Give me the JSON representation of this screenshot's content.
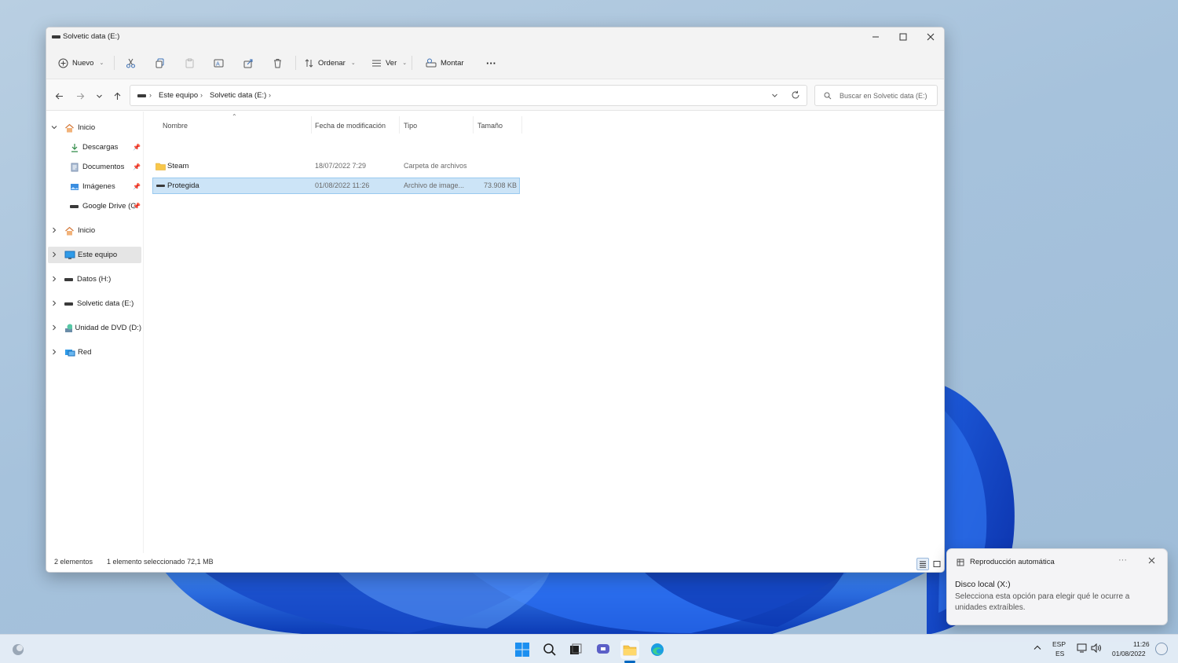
{
  "window": {
    "title": "Solvetic data (E:)"
  },
  "toolbar": {
    "new_label": "Nuevo",
    "sort_label": "Ordenar",
    "view_label": "Ver",
    "mount_label": "Montar",
    "more_label": "···"
  },
  "address": {
    "crumbs": [
      "Este equipo",
      "Solvetic data (E:)"
    ],
    "search_placeholder": "Buscar en Solvetic data (E:)"
  },
  "sidebar": {
    "items": [
      {
        "label": "Inicio",
        "icon": "home-icon"
      },
      {
        "label": "Descargas",
        "icon": "download-icon",
        "pinned": true
      },
      {
        "label": "Documentos",
        "icon": "documents-icon",
        "pinned": true
      },
      {
        "label": "Imágenes",
        "icon": "images-icon",
        "pinned": true
      },
      {
        "label": "Google Drive (G",
        "icon": "drive-icon",
        "pinned": true
      },
      {
        "label": "Inicio",
        "icon": "home-icon"
      },
      {
        "label": "Este equipo",
        "icon": "pc-icon",
        "selected": true
      },
      {
        "label": "Datos (H:)",
        "icon": "drive-icon"
      },
      {
        "label": "Solvetic data (E:)",
        "icon": "drive-icon"
      },
      {
        "label": "Unidad de DVD (D:)",
        "icon": "dvd-icon"
      },
      {
        "label": "Red",
        "icon": "network-icon"
      }
    ]
  },
  "table": {
    "columns": [
      "Nombre",
      "Fecha de modificación",
      "Tipo",
      "Tamaño"
    ],
    "rows": [
      {
        "name": "Steam",
        "date": "18/07/2022 7:29",
        "type": "Carpeta de archivos",
        "size": "",
        "icon": "folder-icon",
        "selected": false
      },
      {
        "name": "Protegida",
        "date": "01/08/2022 11:26",
        "type": "Archivo de image...",
        "size": "73.908 KB",
        "icon": "disk-image-icon",
        "selected": true
      }
    ]
  },
  "status": {
    "count": "2 elementos",
    "selection": "1 elemento seleccionado  72,1 MB"
  },
  "notification": {
    "app": "Reproducción automática",
    "more": "···",
    "heading": "Disco local (X:)",
    "body_line1": "Selecciona esta opción para elegir qué le ocurre a",
    "body_line2": "unidades extraíbles."
  },
  "taskbar": {
    "lang_top": "ESP",
    "lang_bottom": "ES",
    "time": "11:26",
    "date": "01/08/2022"
  },
  "colors": {
    "accent": "#0067c0",
    "selection": "#cce4f7",
    "folder": "#f8c74a"
  }
}
